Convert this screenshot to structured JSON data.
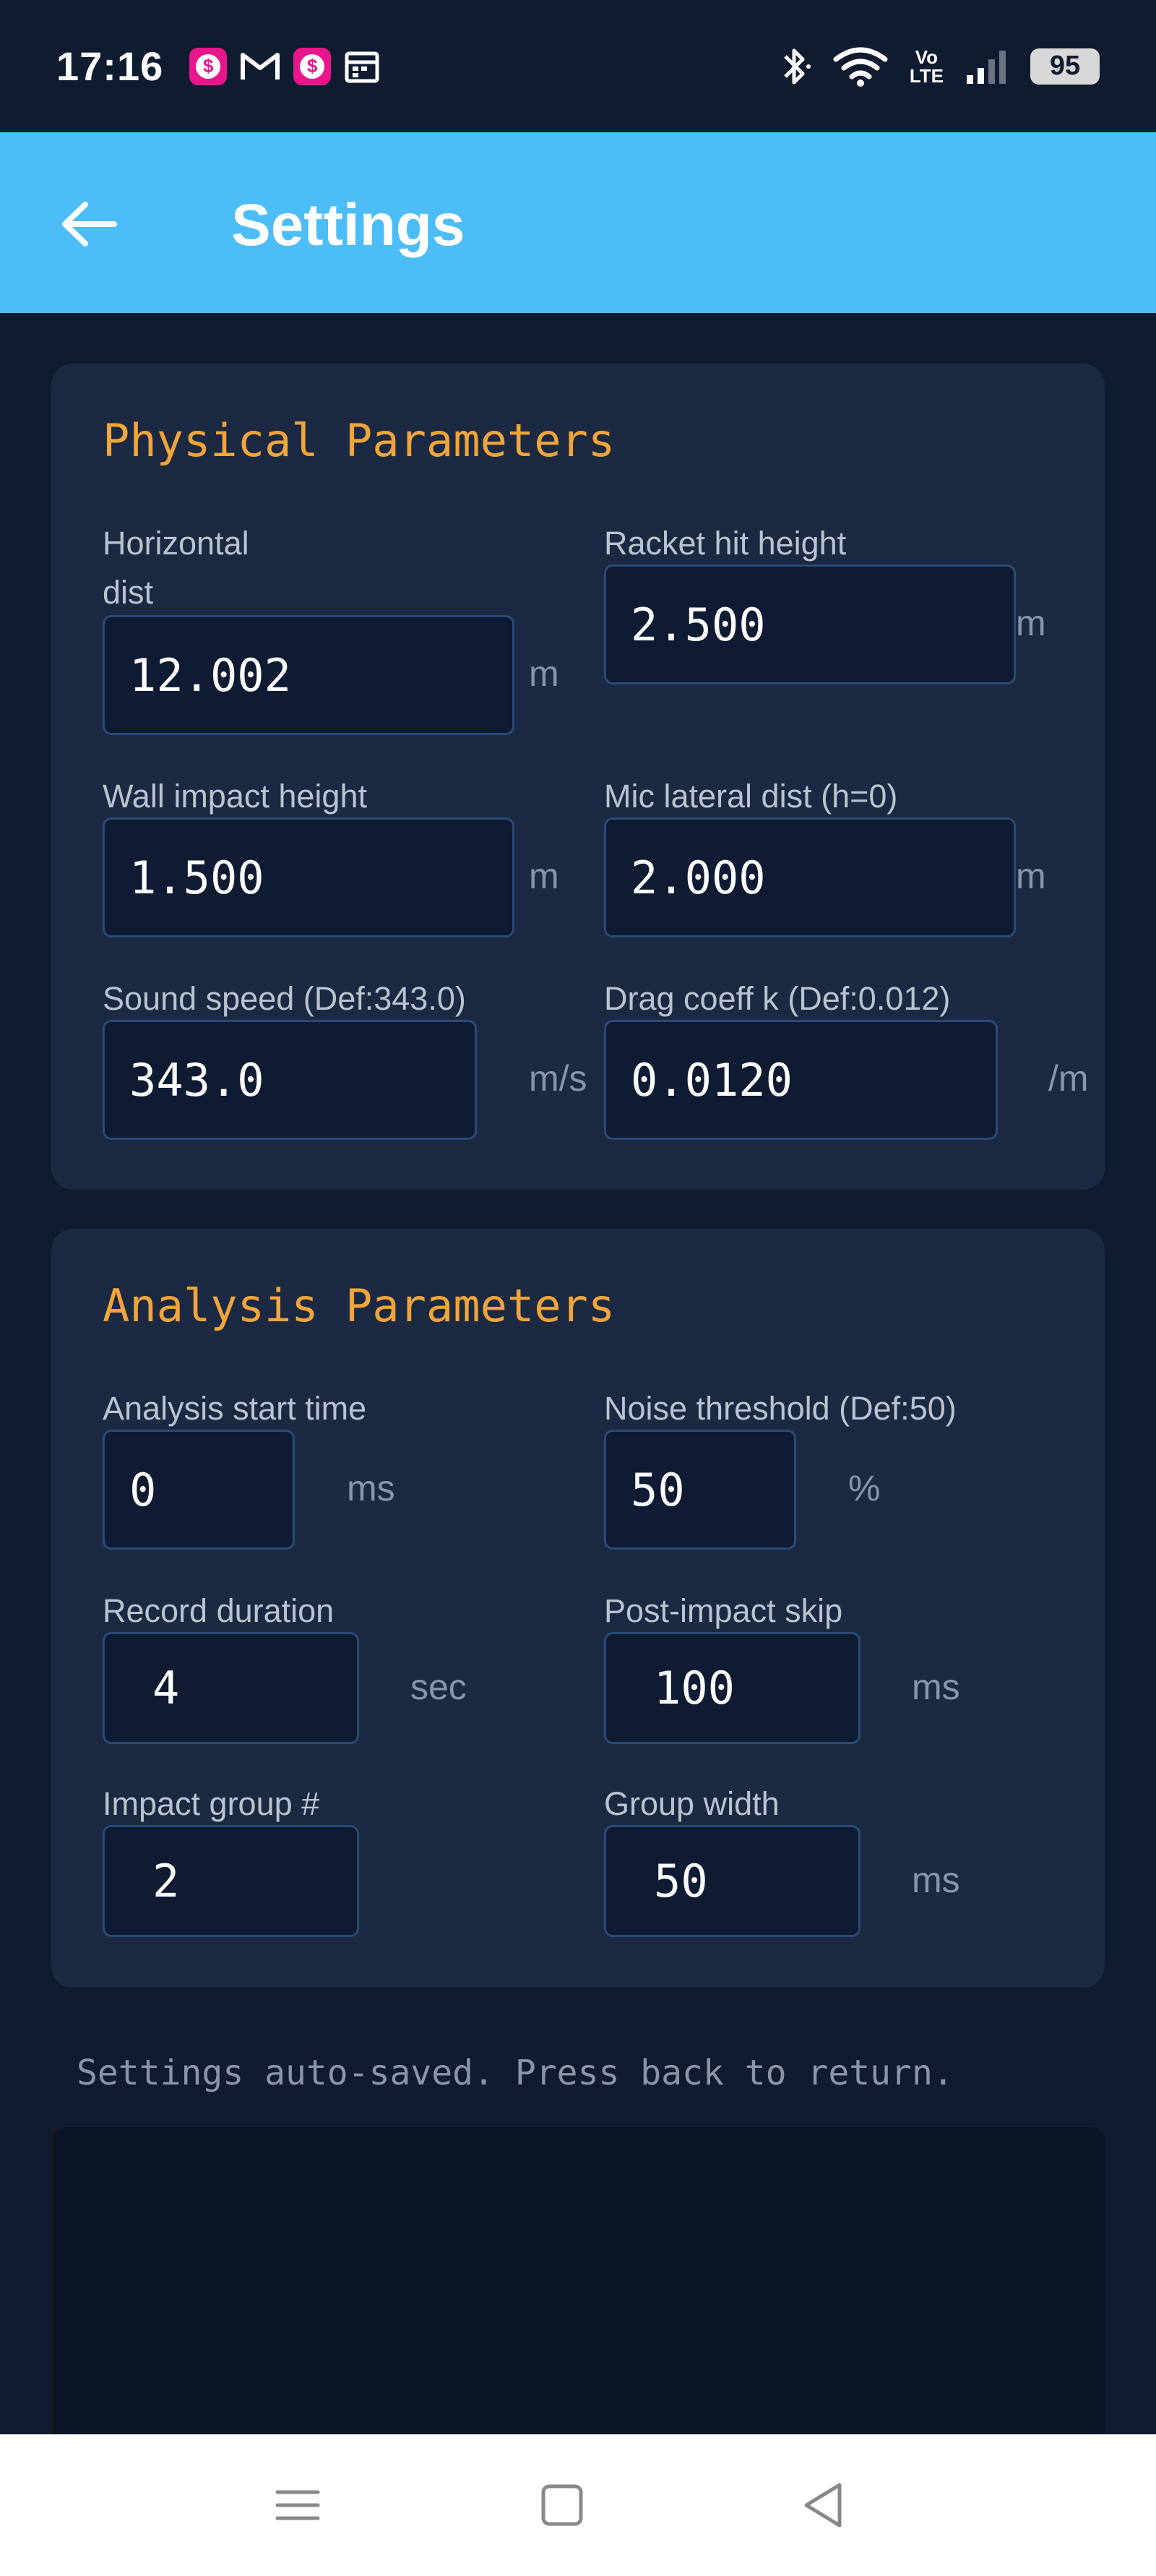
{
  "status_bar": {
    "time": "17:16",
    "battery": "95",
    "network_label": "Vo\nLTE",
    "notif_badge": "$"
  },
  "header": {
    "title": "Settings"
  },
  "physical": {
    "title": "Physical Parameters",
    "fields": [
      {
        "label": "Horizontal dist\n(racket→wall)",
        "value": "12.002",
        "unit": "m"
      },
      {
        "label": "Racket hit height",
        "value": "2.500",
        "unit": "m"
      },
      {
        "label": "Wall impact height",
        "value": "1.500",
        "unit": "m"
      },
      {
        "label": "Mic lateral dist (h=0)",
        "value": "2.000",
        "unit": "m"
      },
      {
        "label": "Sound speed (Def:343.0)",
        "value": "343.0",
        "unit": "m/s"
      },
      {
        "label": "Drag coeff k (Def:0.012)",
        "value": "0.0120",
        "unit": "/m"
      }
    ]
  },
  "analysis": {
    "title": "Analysis Parameters",
    "fields": [
      {
        "label": "Analysis start time",
        "value": "0",
        "unit": "ms"
      },
      {
        "label": "Noise threshold (Def:50)",
        "value": "50",
        "unit": "%"
      },
      {
        "label": "Record duration",
        "value": "4",
        "unit": "sec"
      },
      {
        "label": "Post-impact skip",
        "value": "100",
        "unit": "ms"
      },
      {
        "label": "Impact group #",
        "value": "2",
        "unit": ""
      },
      {
        "label": "Group width",
        "value": "50",
        "unit": "ms"
      }
    ]
  },
  "footer_note": "Settings auto-saved. Press back to return.",
  "colors": {
    "header_bg": "#4dbdf8",
    "page_bg": "#0f1b2f",
    "card_bg": "#1b2a42",
    "title_accent": "#f2a53a"
  }
}
